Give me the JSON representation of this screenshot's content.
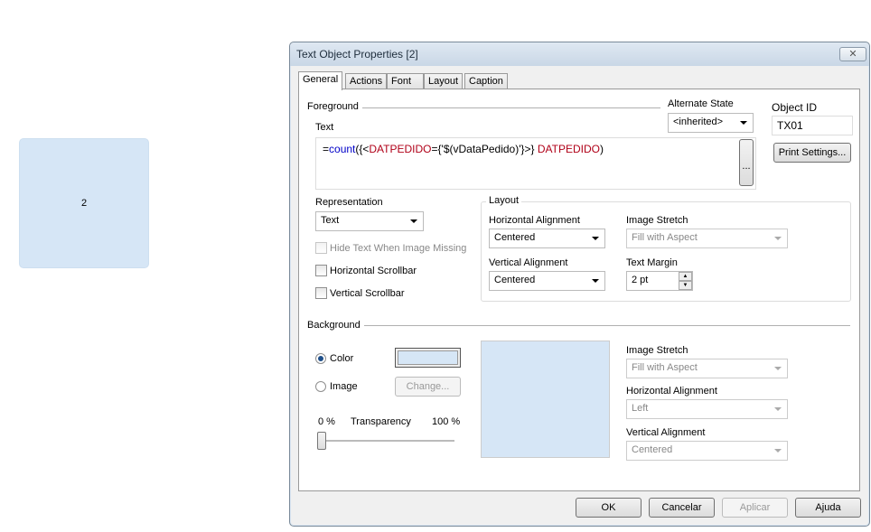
{
  "sheet_object": {
    "value": "2",
    "background": "#d6e6f6"
  },
  "dialog": {
    "title": "Text Object Properties [2]",
    "close_label": "☒",
    "tabs": [
      {
        "label": "General",
        "active": true
      },
      {
        "label": "Actions"
      },
      {
        "label": "Font"
      },
      {
        "label": "Layout"
      },
      {
        "label": "Caption"
      }
    ],
    "foreground": {
      "label": "Foreground",
      "text_label": "Text",
      "expression": {
        "p1": "=",
        "p2": "count",
        "p3": "({<",
        "p4": "DATPEDIDO",
        "p5": "={'$(vDataPedido)'}>} ",
        "p6": "DATPEDIDO",
        "p7": ")"
      },
      "ellipsis": "..."
    },
    "alternate_state": {
      "label": "Alternate State",
      "value": "<inherited>"
    },
    "object_id": {
      "label": "Object ID",
      "value": "TX01"
    },
    "print_settings": "Print Settings...",
    "representation": {
      "label": "Representation",
      "value": "Text"
    },
    "hide_text": {
      "label": "Hide Text When Image Missing",
      "checked": false,
      "disabled": true
    },
    "horizontal_scrollbar": {
      "label": "Horizontal Scrollbar",
      "checked": false
    },
    "vertical_scrollbar": {
      "label": "Vertical Scrollbar",
      "checked": false
    },
    "layout": {
      "label": "Layout",
      "h_align_label": "Horizontal Alignment",
      "h_align": "Centered",
      "v_align_label": "Vertical Alignment",
      "v_align": "Centered",
      "image_stretch_label": "Image Stretch",
      "image_stretch": "Fill with Aspect",
      "text_margin_label": "Text Margin",
      "text_margin": "2 pt"
    },
    "background": {
      "label": "Background",
      "color_label": "Color",
      "image_label": "Image",
      "change": "Change...",
      "color": "#d6e6f6",
      "selected": "Color",
      "transparency_label": "Transparency",
      "min": "0 %",
      "max": "100 %",
      "transparency": 0,
      "image_stretch_label": "Image Stretch",
      "image_stretch": "Fill with Aspect",
      "h_align_label": "Horizontal Alignment",
      "h_align": "Left",
      "v_align_label": "Vertical Alignment",
      "v_align": "Centered"
    },
    "buttons": {
      "ok": "OK",
      "cancel": "Cancelar",
      "apply": "Aplicar",
      "help": "Ajuda"
    }
  }
}
